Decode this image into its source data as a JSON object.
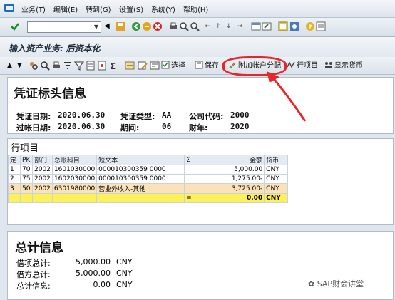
{
  "menu": [
    "业务(T)",
    "编辑(E)",
    "转到(G)",
    "设置(S)",
    "系统(Y)",
    "帮助(H)"
  ],
  "title": "输入资产业务: 后资本化",
  "toolbar": {
    "select": "选择",
    "save": "保存",
    "assign": "附加帐户分配",
    "items": "行项目",
    "currency": "显示货币"
  },
  "header": {
    "title": "凭证标头信息",
    "doc_date_label": "凭证日期:",
    "doc_date": "2020.06.30",
    "doc_type_label": "凭证类型:",
    "doc_type": "AA",
    "company_label": "公司代码:",
    "company": "2000",
    "post_date_label": "过帐日期:",
    "post_date": "2020.06.30",
    "period_label": "期间:",
    "period": "06",
    "year_label": "财年:",
    "year": "2020"
  },
  "items": {
    "title": "行项目",
    "columns": [
      "定",
      "PK",
      "部门",
      "总账科目",
      "短文本",
      "Σ",
      "金额",
      "货币"
    ],
    "rows": [
      {
        "no": "1",
        "pk": "70",
        "dept": "2002",
        "gl": "1601030000",
        "text": "000010300359 0000",
        "amount": "5,000.00",
        "cur": "CNY"
      },
      {
        "no": "2",
        "pk": "75",
        "dept": "2002",
        "gl": "1602030000",
        "text": "000010300359 0000",
        "amount": "1,275.00-",
        "cur": "CNY"
      },
      {
        "no": "3",
        "pk": "50",
        "dept": "2002",
        "gl": "6301980000",
        "text": "营业外收入-其他",
        "amount": "3,725.00-",
        "cur": "CNY"
      }
    ],
    "total_sigma": "=",
    "total": "0.00",
    "total_cur": "CNY"
  },
  "totals": {
    "title": "总计信息",
    "debit_label": "借项总计:",
    "debit": "5,000.00",
    "debit_cur": "CNY",
    "credit_label": "借方总计:",
    "credit": "5,000.00",
    "credit_cur": "CNY",
    "info_label": "总计信息:",
    "info": "0.00",
    "info_cur": "CNY"
  },
  "watermark": "SAP财会讲堂",
  "colors": {
    "highlight": "#e8262a",
    "selected_row": "#fbe2b8",
    "total_row": "#fdf15a"
  }
}
